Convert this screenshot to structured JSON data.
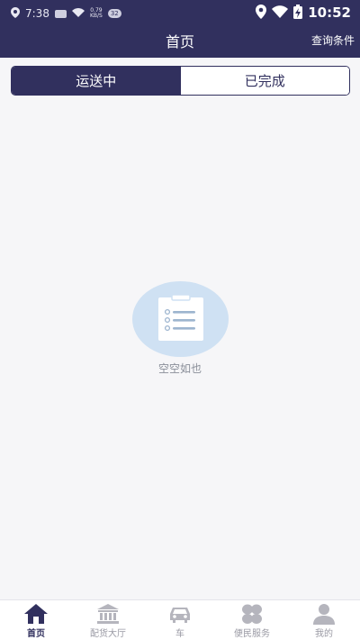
{
  "status_bar": {
    "left_time": "7:38",
    "net_speed_value": "0.79",
    "net_speed_unit": "KB/S",
    "badge": "32",
    "right_time": "10:52"
  },
  "header": {
    "title": "首页",
    "query_button": "查询条件"
  },
  "tabs": [
    {
      "label": "运送中",
      "active": true
    },
    {
      "label": "已完成",
      "active": false
    }
  ],
  "empty_state": {
    "text": "空空如也",
    "icon": "clipboard-list-icon"
  },
  "bottom_nav": [
    {
      "label": "首页",
      "icon": "home-icon",
      "active": true
    },
    {
      "label": "配货大厅",
      "icon": "bank-building-icon",
      "active": false
    },
    {
      "label": "车",
      "icon": "car-icon",
      "active": false
    },
    {
      "label": "便民服务",
      "icon": "grid-service-icon",
      "active": false
    },
    {
      "label": "我的",
      "icon": "person-icon",
      "active": false
    }
  ],
  "colors": {
    "primary": "#31305e",
    "background": "#f6f6f8",
    "empty_circle": "#cfe1f3",
    "inactive_nav": "#b5b5bd"
  }
}
